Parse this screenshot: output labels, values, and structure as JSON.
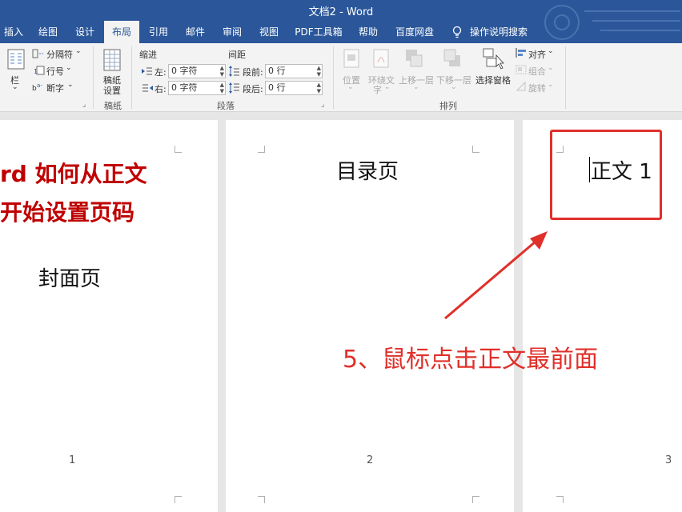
{
  "window": {
    "title": "文档2 - Word"
  },
  "tabs": [
    {
      "label": "插入",
      "active": false
    },
    {
      "label": "绘图",
      "active": false
    },
    {
      "label": "设计",
      "active": false
    },
    {
      "label": "布局",
      "active": true
    },
    {
      "label": "引用",
      "active": false
    },
    {
      "label": "邮件",
      "active": false
    },
    {
      "label": "审阅",
      "active": false
    },
    {
      "label": "视图",
      "active": false
    },
    {
      "label": "PDF工具箱",
      "active": false
    },
    {
      "label": "帮助",
      "active": false
    },
    {
      "label": "百度网盘",
      "active": false
    }
  ],
  "tellme": {
    "label": "操作说明搜索",
    "icon": "lightbulb-icon"
  },
  "ribbon": {
    "page_setup": {
      "columns_label": "栏",
      "breaks_label": "分隔符",
      "line_numbers_label": "行号",
      "hyphenation_label": "断字",
      "chevron": "⌄"
    },
    "manuscript": {
      "button_label_line1": "稿纸",
      "button_label_line2": "设置",
      "group_label": "稿纸"
    },
    "paragraph": {
      "indent_header": "缩进",
      "spacing_header": "间距",
      "left_label": "左:",
      "left_value": "0 字符",
      "right_label": "右:",
      "right_value": "0 字符",
      "before_label": "段前:",
      "before_value": "0 行",
      "after_label": "段后:",
      "after_value": "0 行",
      "group_label": "段落"
    },
    "arrange": {
      "position_label": "位置",
      "wrap_text_label_line1": "环绕文",
      "wrap_text_label_line2": "字",
      "bring_forward_label": "上移一层",
      "send_backward_label": "下移一层",
      "selection_pane_label": "选择窗格",
      "align_label": "对齐",
      "group_objects_label": "组合",
      "rotate_label": "旋转",
      "group_label": "排列"
    }
  },
  "document": {
    "page1": {
      "title_line1": "rd 如何从正文",
      "title_line2": "开始设置页码",
      "body_text": "封面页",
      "page_number": "1"
    },
    "page2": {
      "body_text": "目录页",
      "page_number": "2"
    },
    "page3": {
      "body_text": "正文 1",
      "page_number": "3"
    }
  },
  "annotation": {
    "text": "5、鼠标点击正文最前面",
    "color": "#e0302a"
  },
  "colors": {
    "titlebar": "#2b579a",
    "ribbon": "#f3f3f3",
    "accent_red": "#c00000"
  }
}
